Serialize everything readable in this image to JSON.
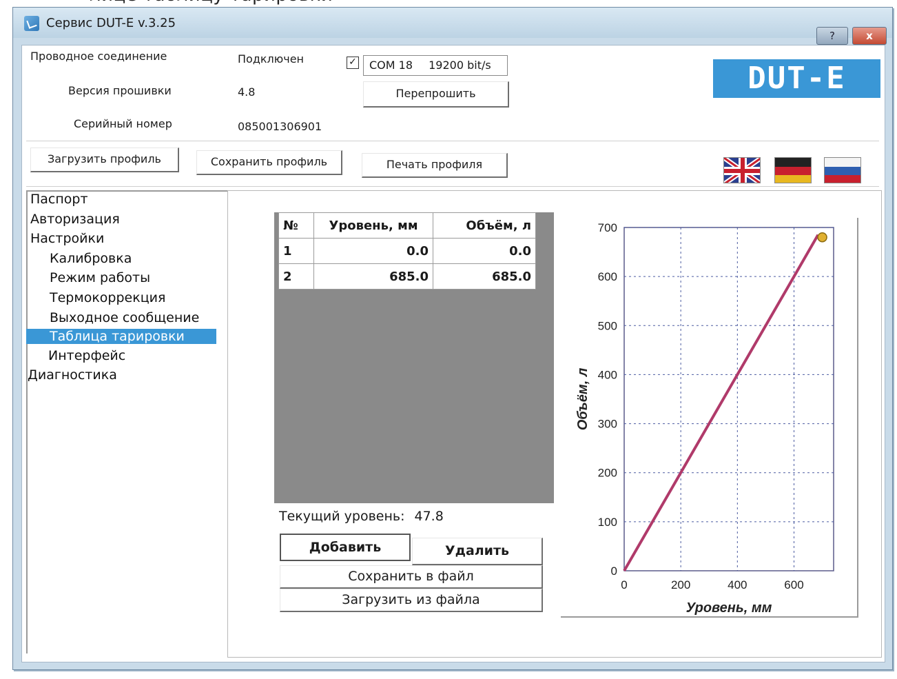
{
  "caption": "лице таблицу тарировки",
  "window": {
    "title": "Сервис DUT-E  v.3.25",
    "help_label": "?",
    "close_label": "x"
  },
  "connection": {
    "wired_label": "Проводное соединение",
    "wired_status": "Подключен",
    "checkbox_mark": "✓",
    "port": "COM 18",
    "baud": "19200 bit/s",
    "firmware_label": "Версия прошивки",
    "firmware_value": "4.8",
    "reflash_button": "Перепрошить",
    "serial_label": "Серийный номер",
    "serial_value": "085001306901"
  },
  "logo_text": "DUT-E",
  "profile": {
    "load": "Загрузить профиль",
    "save": "Сохранить профиль",
    "print": "Печать профиля"
  },
  "languages": [
    "english-flag",
    "german-flag",
    "russian-flag"
  ],
  "tree": {
    "items": [
      "Паспорт",
      "Авторизация",
      "Настройки",
      "Калибровка",
      "Режим работы",
      "Термокоррекция",
      "Выходное сообщение",
      "Таблица тарировки",
      "Интерфейс",
      "Диагностика"
    ],
    "selected": "Таблица тарировки"
  },
  "table": {
    "headers": [
      "№",
      "Уровень, мм",
      "Объём, л"
    ],
    "rows": [
      [
        "1",
        "0.0",
        "0.0"
      ],
      [
        "2",
        "685.0",
        "685.0"
      ]
    ]
  },
  "current_level": {
    "label": "Текущий уровень:",
    "value": "47.8"
  },
  "actions": {
    "add": "Добавить",
    "delete": "Удалить",
    "save_file": "Сохранить в файл",
    "load_file": "Загрузить из файла"
  },
  "chart_data": {
    "type": "line",
    "xlabel": "Уровень, мм",
    "ylabel": "Объём, л",
    "xlim": [
      0,
      740
    ],
    "ylim": [
      0,
      700
    ],
    "x_ticks": [
      0,
      200,
      400,
      600
    ],
    "y_ticks": [
      0,
      100,
      200,
      300,
      400,
      500,
      600,
      700
    ],
    "grid": true,
    "series": [
      {
        "x": [
          0,
          685
        ],
        "y": [
          0,
          685
        ]
      }
    ],
    "marker": {
      "x": 700,
      "y": 680
    },
    "colors": {
      "line": "#b03a6a",
      "marker": "#e0b030",
      "grid": "#4a5aa0"
    }
  }
}
